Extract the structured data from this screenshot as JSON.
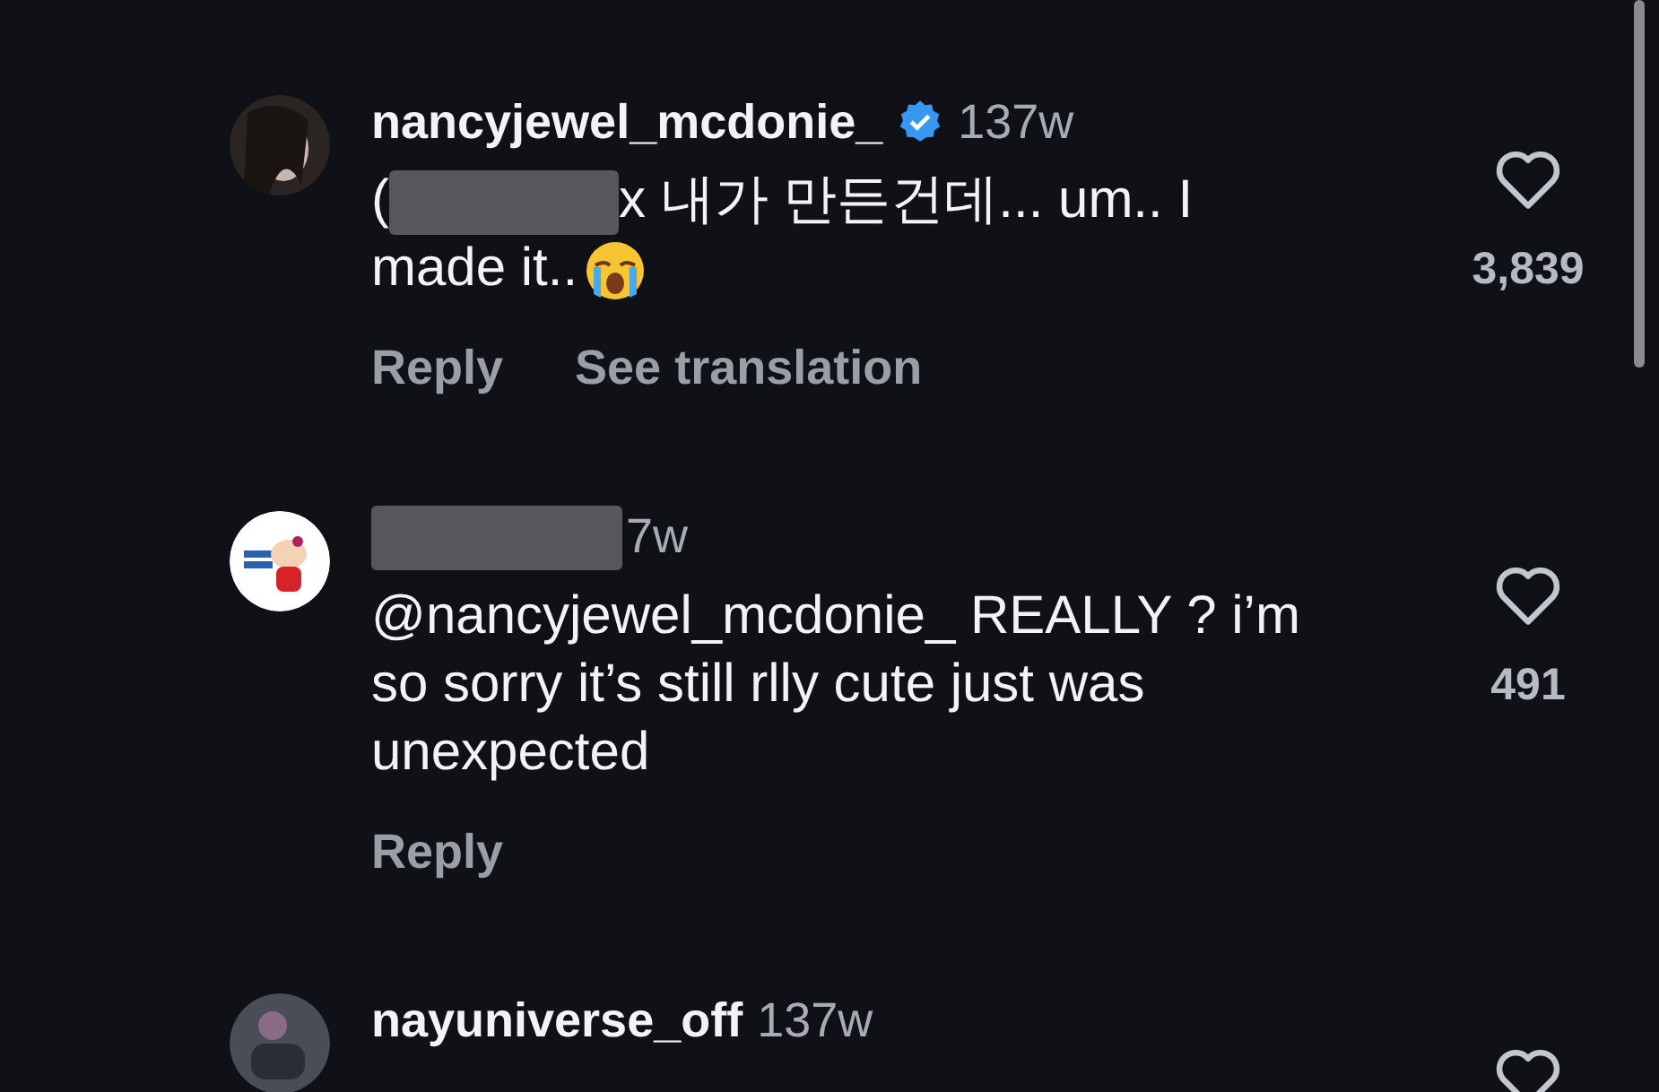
{
  "comments": [
    {
      "username": "nancyjewel_mcdonie_",
      "verified": true,
      "time": "137w",
      "text_parts": [
        {
          "kind": "text",
          "text": "("
        },
        {
          "kind": "redacted"
        },
        {
          "kind": "text",
          "text": "x 내가 만든건데... um.. I made it.."
        },
        {
          "kind": "emoji"
        }
      ],
      "actions": [
        "Reply",
        "See translation"
      ],
      "likes": "3,839"
    },
    {
      "redacted_name": true,
      "time": "7w",
      "text_parts": [
        {
          "kind": "text",
          "text": "@nancyjewel_mcdonie_ REALLY ? i’m so sorry it’s still rlly cute just was unexpected"
        }
      ],
      "actions": [
        "Reply"
      ],
      "likes": "491"
    },
    {
      "username": "nayuniverse_off",
      "time": "137w"
    }
  ]
}
